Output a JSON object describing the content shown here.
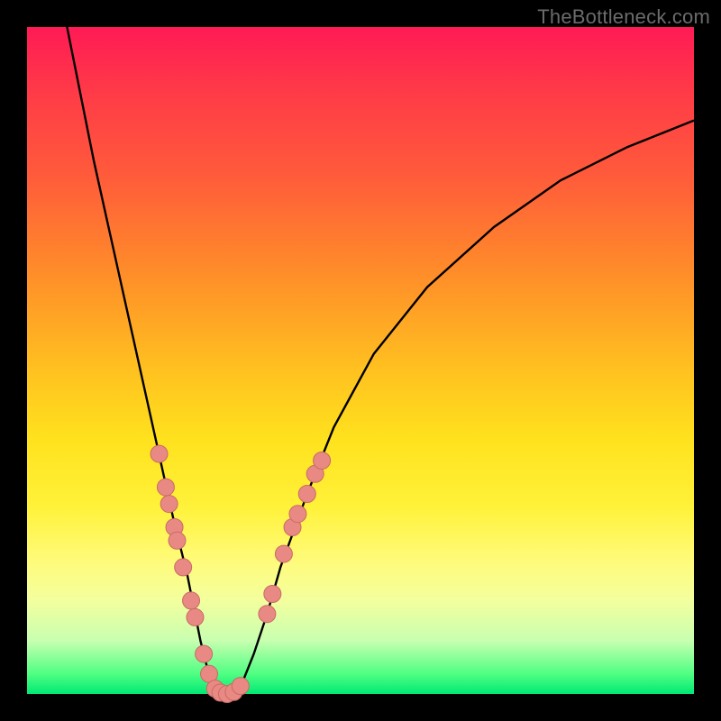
{
  "watermark": "TheBottleneck.com",
  "colors": {
    "page_bg": "#000000",
    "curve": "#000000",
    "marker_fill": "#e98984",
    "marker_stroke": "#c96a65"
  },
  "chart_data": {
    "type": "line",
    "title": "",
    "xlabel": "",
    "ylabel": "",
    "xlim": [
      0,
      100
    ],
    "ylim": [
      0,
      100
    ],
    "grid": false,
    "legend": false,
    "series": [
      {
        "name": "bottleneck-curve",
        "x": [
          6,
          8,
          10,
          12,
          14,
          16,
          18,
          20,
          22,
          23,
          24,
          25,
          26,
          27,
          28,
          29,
          30,
          31,
          32,
          34,
          36,
          38,
          42,
          46,
          52,
          60,
          70,
          80,
          90,
          100
        ],
        "y": [
          100,
          90,
          80,
          71,
          62,
          53,
          44,
          35,
          26,
          22,
          18,
          13,
          8,
          4,
          1,
          0,
          0,
          0,
          1,
          6,
          12,
          19,
          30,
          40,
          51,
          61,
          70,
          77,
          82,
          86
        ]
      }
    ],
    "markers": [
      {
        "x": 19.8,
        "y": 36
      },
      {
        "x": 20.8,
        "y": 31
      },
      {
        "x": 21.3,
        "y": 28.5
      },
      {
        "x": 22.1,
        "y": 25
      },
      {
        "x": 22.5,
        "y": 23
      },
      {
        "x": 23.4,
        "y": 19
      },
      {
        "x": 24.6,
        "y": 14
      },
      {
        "x": 25.2,
        "y": 11.5
      },
      {
        "x": 26.5,
        "y": 6
      },
      {
        "x": 27.3,
        "y": 3
      },
      {
        "x": 28.2,
        "y": 0.8
      },
      {
        "x": 29.0,
        "y": 0.2
      },
      {
        "x": 30.0,
        "y": 0
      },
      {
        "x": 31.0,
        "y": 0.3
      },
      {
        "x": 32.0,
        "y": 1.2
      },
      {
        "x": 36.0,
        "y": 12
      },
      {
        "x": 36.8,
        "y": 15
      },
      {
        "x": 38.5,
        "y": 21
      },
      {
        "x": 39.8,
        "y": 25
      },
      {
        "x": 40.6,
        "y": 27
      },
      {
        "x": 42.0,
        "y": 30
      },
      {
        "x": 43.2,
        "y": 33
      },
      {
        "x": 44.2,
        "y": 35
      }
    ]
  }
}
